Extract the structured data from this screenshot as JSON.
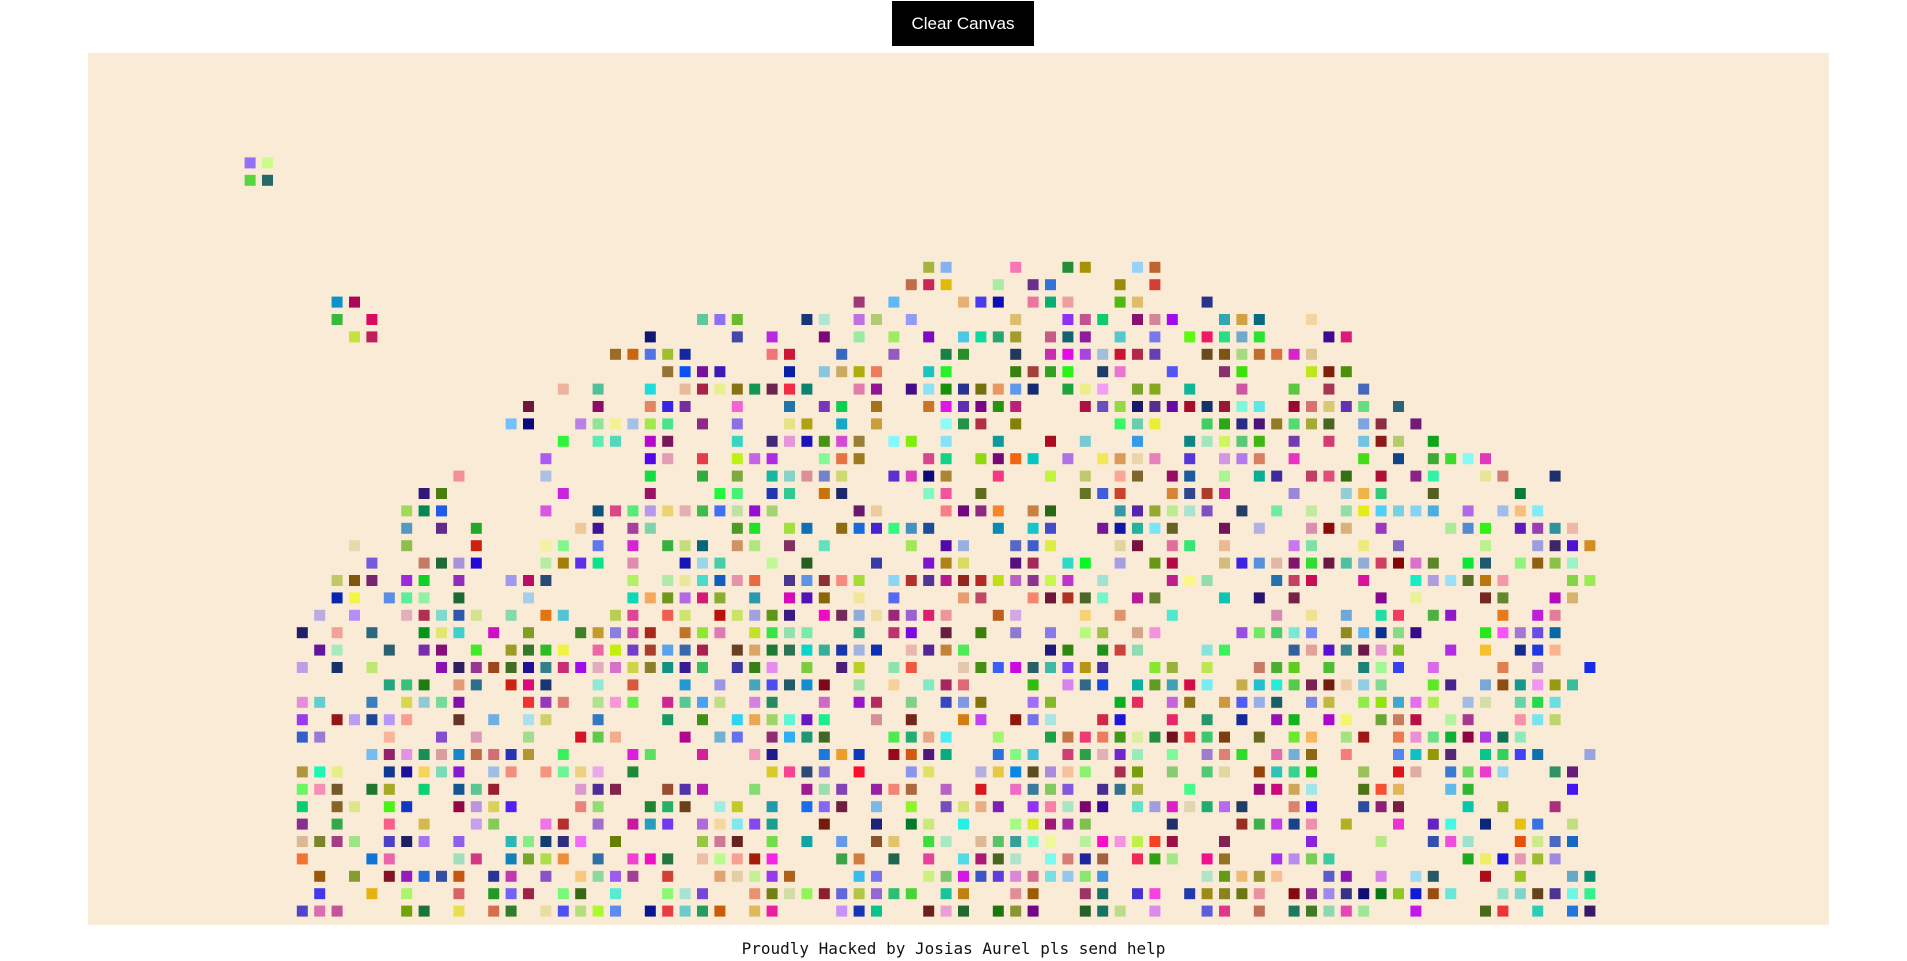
{
  "toolbar": {
    "clear_label": "Clear Canvas"
  },
  "canvas": {
    "background": "#FAEBD7"
  },
  "footer": {
    "text": "Proudly Hacked by Josias Aurel pls send help"
  }
}
